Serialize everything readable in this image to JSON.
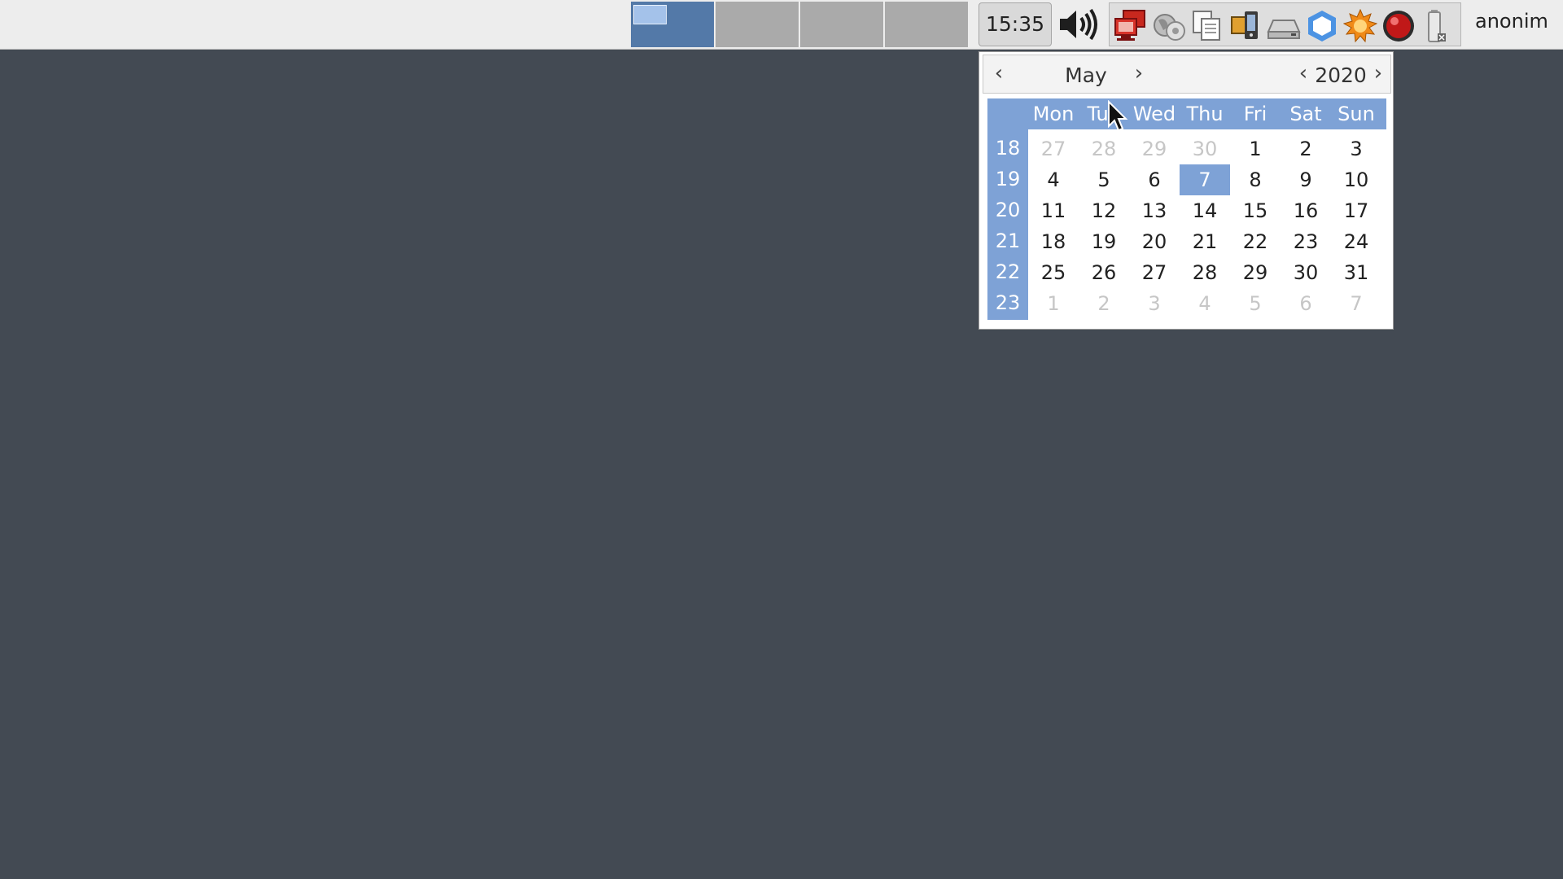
{
  "panel": {
    "clock": "15:35",
    "username": "anonim",
    "workspaces": [
      {
        "active": true
      },
      {
        "active": false
      },
      {
        "active": false
      },
      {
        "active": false
      }
    ],
    "volume_icon": "speaker-volume-icon",
    "tray_icons": [
      "network-computers-icon",
      "world-network-icon",
      "clipboard-documents-icon",
      "mobile-devices-icon",
      "removable-drive-icon",
      "hexagon-app-icon",
      "sun-gear-icon",
      "record-red-icon",
      "battery-icon"
    ]
  },
  "calendar": {
    "month": "May",
    "year": "2020",
    "weekdays": [
      "Mon",
      "Tue",
      "Wed",
      "Thu",
      "Fri",
      "Sat",
      "Sun"
    ],
    "weeks": [
      {
        "number": "18",
        "days": [
          {
            "d": "27",
            "other": true
          },
          {
            "d": "28",
            "other": true
          },
          {
            "d": "29",
            "other": true
          },
          {
            "d": "30",
            "other": true
          },
          {
            "d": "1"
          },
          {
            "d": "2"
          },
          {
            "d": "3"
          }
        ]
      },
      {
        "number": "19",
        "days": [
          {
            "d": "4"
          },
          {
            "d": "5"
          },
          {
            "d": "6"
          },
          {
            "d": "7",
            "selected": true
          },
          {
            "d": "8"
          },
          {
            "d": "9"
          },
          {
            "d": "10"
          }
        ]
      },
      {
        "number": "20",
        "days": [
          {
            "d": "11"
          },
          {
            "d": "12"
          },
          {
            "d": "13"
          },
          {
            "d": "14"
          },
          {
            "d": "15"
          },
          {
            "d": "16"
          },
          {
            "d": "17"
          }
        ]
      },
      {
        "number": "21",
        "days": [
          {
            "d": "18"
          },
          {
            "d": "19"
          },
          {
            "d": "20"
          },
          {
            "d": "21"
          },
          {
            "d": "22"
          },
          {
            "d": "23"
          },
          {
            "d": "24"
          }
        ]
      },
      {
        "number": "22",
        "days": [
          {
            "d": "25"
          },
          {
            "d": "26"
          },
          {
            "d": "27"
          },
          {
            "d": "28"
          },
          {
            "d": "29"
          },
          {
            "d": "30"
          },
          {
            "d": "31"
          }
        ]
      },
      {
        "number": "23",
        "days": [
          {
            "d": "1",
            "other": true
          },
          {
            "d": "2",
            "other": true
          },
          {
            "d": "3",
            "other": true
          },
          {
            "d": "4",
            "other": true
          },
          {
            "d": "5",
            "other": true
          },
          {
            "d": "6",
            "other": true
          },
          {
            "d": "7",
            "other": true
          }
        ]
      }
    ],
    "prev_month_glyph": "‹",
    "next_month_glyph": "›",
    "prev_year_glyph": "‹",
    "next_year_glyph": "›"
  },
  "colors": {
    "desktop": "#434a53",
    "panel": "#ededed",
    "accent": "#7ea2d6",
    "active_workspace": "#5379a8"
  }
}
